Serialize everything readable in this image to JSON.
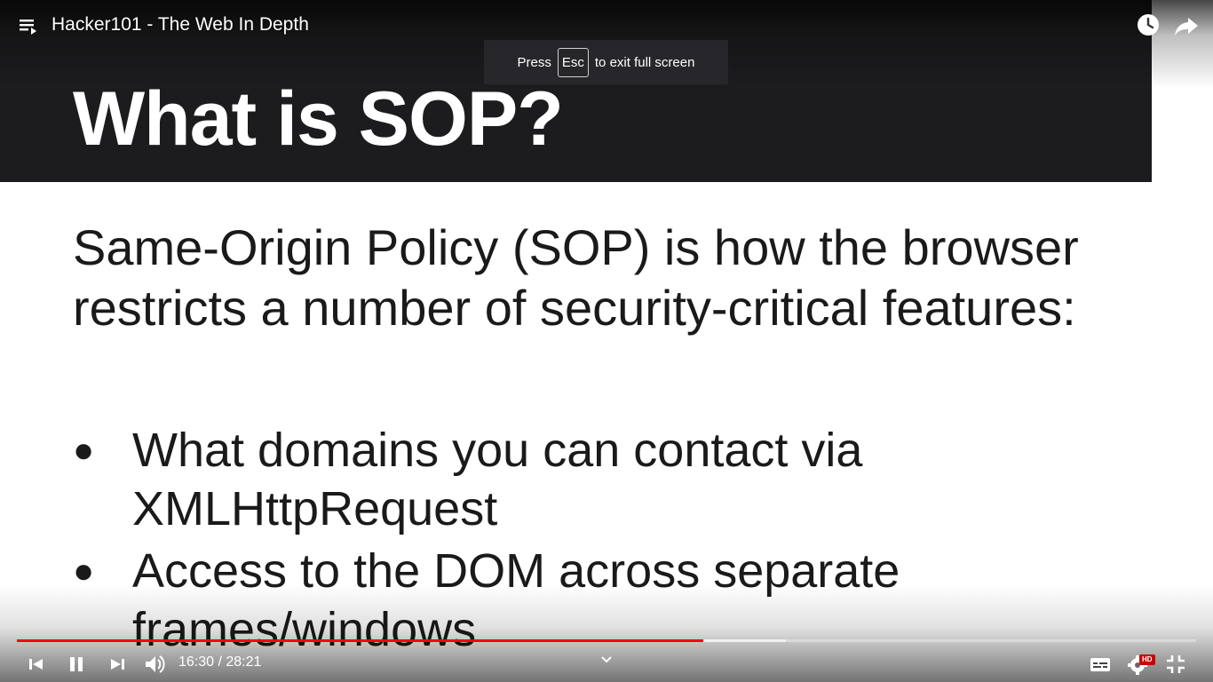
{
  "slide": {
    "title": "What is SOP?",
    "body": "Same-Origin Policy (SOP) is how the browser restricts a number of security-critical features:",
    "bullets": [
      "What domains you can contact via XMLHttpRequest",
      "Access to the DOM across separate frames/windows"
    ],
    "bullet_glyph": "●"
  },
  "player": {
    "title": "Hacker101 - The Web In Depth",
    "fullscreen_notice": {
      "prefix": "Press",
      "key": "Esc",
      "suffix": "to exit full screen"
    },
    "time": {
      "current": "16:30",
      "separator": " / ",
      "duration": "28:21"
    },
    "progress": {
      "played_fraction": 0.582,
      "buffered_fraction": 0.652
    },
    "hd_badge": "HD",
    "icons": [
      "playlist-icon",
      "watch-later-icon",
      "share-icon",
      "previous-icon",
      "pause-icon",
      "next-icon",
      "volume-icon",
      "chevron-down-icon",
      "subtitles-icon",
      "settings-icon",
      "exit-fullscreen-icon"
    ],
    "colors": {
      "progress": "#ff0000",
      "slide_header": "#1c1c1e",
      "hd_badge": "#cc0000"
    }
  }
}
